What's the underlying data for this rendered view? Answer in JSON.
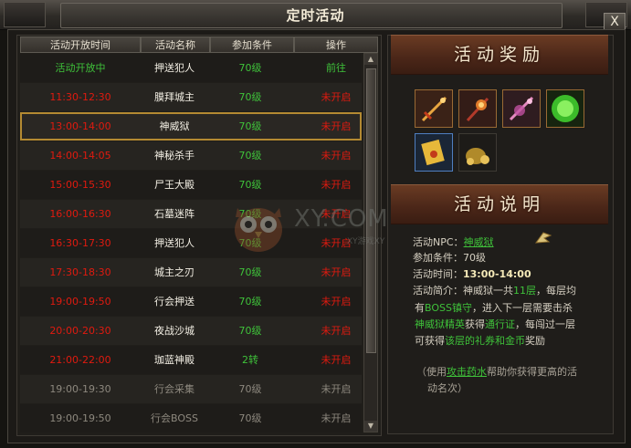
{
  "window": {
    "title": "定时活动",
    "close_label": "X"
  },
  "table": {
    "headers": [
      "活动开放时间",
      "活动名称",
      "参加条件",
      "操作"
    ],
    "rows": [
      {
        "time": "活动开放中",
        "name": "押送犯人",
        "cond": "70级",
        "op": "前往",
        "time_color": "green",
        "op_color": "green"
      },
      {
        "time": "11:30-12:30",
        "name": "膜拜城主",
        "cond": "70级",
        "op": "未开启",
        "time_color": "red",
        "op_color": "red"
      },
      {
        "time": "13:00-14:00",
        "name": "神威狱",
        "cond": "70级",
        "op": "未开启",
        "time_color": "red",
        "op_color": "red",
        "selected": true
      },
      {
        "time": "14:00-14:05",
        "name": "神秘杀手",
        "cond": "70级",
        "op": "未开启",
        "time_color": "red",
        "op_color": "red"
      },
      {
        "time": "15:00-15:30",
        "name": "尸王大殿",
        "cond": "70级",
        "op": "未开启",
        "time_color": "red",
        "op_color": "red"
      },
      {
        "time": "16:00-16:30",
        "name": "石墓迷阵",
        "cond": "70级",
        "op": "未开启",
        "time_color": "red",
        "op_color": "red"
      },
      {
        "time": "16:30-17:30",
        "name": "押送犯人",
        "cond": "70级",
        "op": "未开启",
        "time_color": "red",
        "op_color": "red"
      },
      {
        "time": "17:30-18:30",
        "name": "城主之刃",
        "cond": "70级",
        "op": "未开启",
        "time_color": "red",
        "op_color": "red"
      },
      {
        "time": "19:00-19:50",
        "name": "行会押送",
        "cond": "70级",
        "op": "未开启",
        "time_color": "red",
        "op_color": "red"
      },
      {
        "time": "20:00-20:30",
        "name": "夜战沙城",
        "cond": "70级",
        "op": "未开启",
        "time_color": "red",
        "op_color": "red"
      },
      {
        "time": "21:00-22:00",
        "name": "珈蓝神殿",
        "cond": "2转",
        "op": "未开启",
        "time_color": "red",
        "op_color": "red"
      },
      {
        "time": "19:00-19:30",
        "name": "行会采集",
        "cond": "70级",
        "op": "未开启",
        "time_color": "grey",
        "op_color": "grey",
        "dim": true
      },
      {
        "time": "19:00-19:50",
        "name": "行会BOSS",
        "cond": "70级",
        "op": "未开启",
        "time_color": "grey",
        "op_color": "grey",
        "dim": true
      }
    ]
  },
  "rewards": {
    "banner": "活动奖励",
    "items": [
      "sword-item-icon",
      "staff-item-icon",
      "fan-item-icon",
      "experience-orb-icon",
      "scroll-item-icon",
      "gold-bag-icon"
    ]
  },
  "description": {
    "banner": "活动说明",
    "npc_label": "活动NPC：",
    "npc_name": "神威狱",
    "cond_label": "参加条件：",
    "cond_value": "70级",
    "time_label": "活动时间：",
    "time_value": "13:00-14:00",
    "intro_label": "活动简介：",
    "intro_p1": "神威狱一共",
    "intro_floors": "11层",
    "intro_p2": "，每层均",
    "line2_a": "有",
    "line2_b": "BOSS镇守",
    "line2_c": "，进入下一层需要击杀",
    "line3_a": "神威狱精英",
    "line3_b": "获得",
    "line3_c": "通行证",
    "line3_d": "，每闯过一层",
    "line4_a": "可获得",
    "line4_b": "该层的礼券和金币",
    "line4_c": "奖励",
    "note_a": "（使用",
    "note_link": "攻击药水",
    "note_b": "帮助你获得更高的活",
    "note_c": "动名次）"
  },
  "watermark": {
    "text": "XY.COM",
    "sub": "XY游戏XY"
  },
  "colors": {
    "red": "#e01a0f",
    "green": "#3fc23a",
    "gold_border": "#b48a32"
  }
}
